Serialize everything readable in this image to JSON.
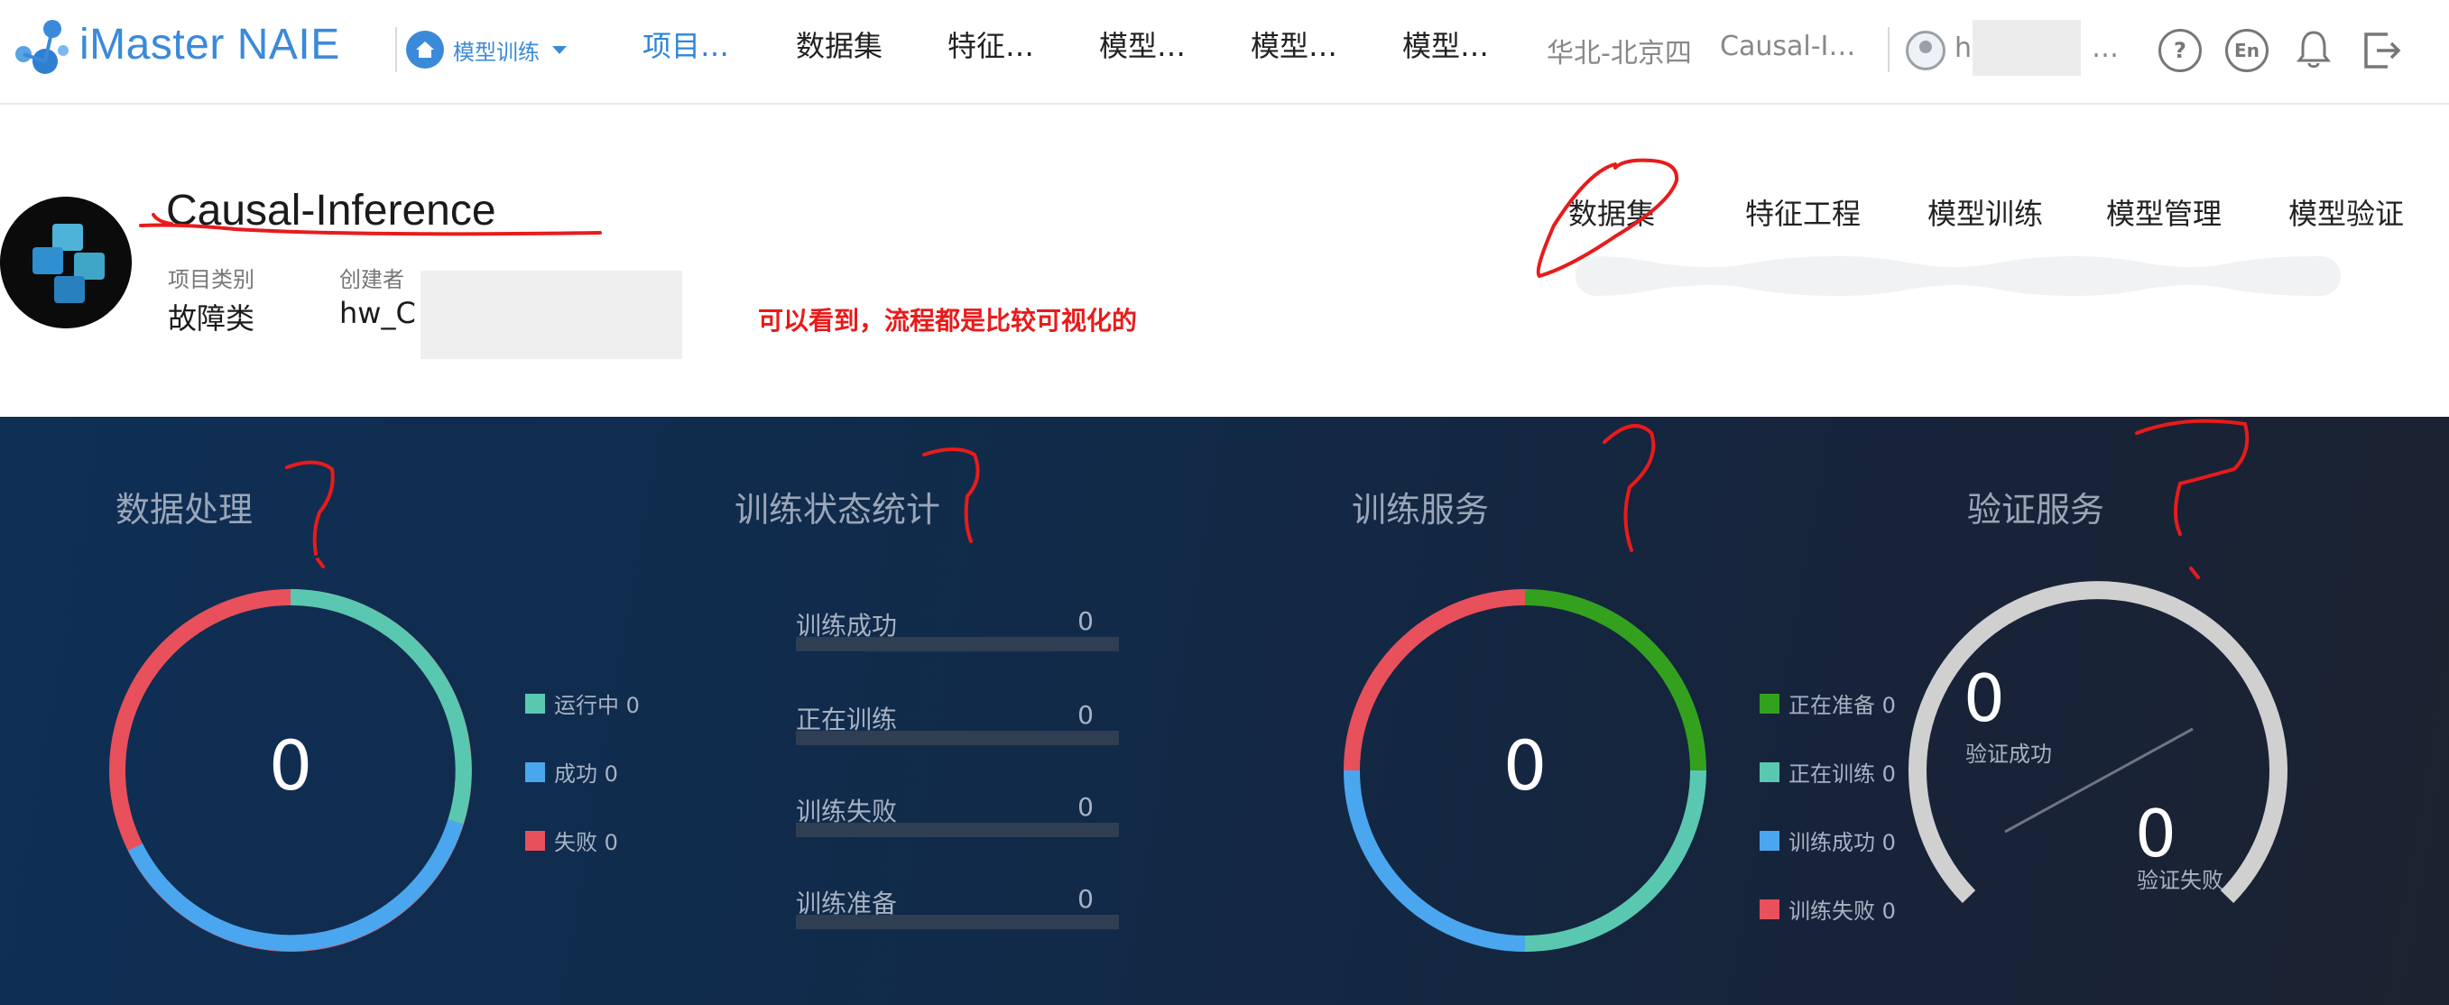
{
  "header": {
    "brand": "iMaster NAIE",
    "module_select": "模型训练",
    "tabs": [
      {
        "label": "项目…",
        "active": true
      },
      {
        "label": "数据集",
        "active": false
      },
      {
        "label": "特征…",
        "active": false
      },
      {
        "label": "模型…",
        "active": false
      },
      {
        "label": "模型…",
        "active": false
      },
      {
        "label": "模型…",
        "active": false
      }
    ],
    "region": "华北-北京四",
    "project_short": "Causal-I…",
    "user_partial": "h",
    "user_ellipsis": "…",
    "lang_label": "En",
    "help_label": "?"
  },
  "project": {
    "name": "Causal-Inference",
    "category_label": "项目类别",
    "category_value": "故障类",
    "creator_label": "创建者",
    "creator_value": "hw_C"
  },
  "annotation": "可以看到，流程都是比较可视化的",
  "flow_tabs": [
    "数据集",
    "特征工程",
    "模型训练",
    "模型管理",
    "模型验证"
  ],
  "dashboard": {
    "data_processing": {
      "title": "数据处理",
      "center": "0",
      "legend": [
        {
          "label": "运行中 0",
          "color": "#5ac8b0"
        },
        {
          "label": "成功 0",
          "color": "#4aa6ee"
        },
        {
          "label": "失败 0",
          "color": "#e8505b"
        }
      ]
    },
    "training_stats": {
      "title": "训练状态统计",
      "rows": [
        {
          "label": "训练成功",
          "value": "0"
        },
        {
          "label": "正在训练",
          "value": "0"
        },
        {
          "label": "训练失败",
          "value": "0"
        },
        {
          "label": "训练准备",
          "value": "0"
        }
      ]
    },
    "training_service": {
      "title": "训练服务",
      "center": "0",
      "legend": [
        {
          "label": "正在准备 0",
          "color": "#33a11e"
        },
        {
          "label": "正在训练 0",
          "color": "#5ac8b0"
        },
        {
          "label": "训练成功 0",
          "color": "#4aa6ee"
        },
        {
          "label": "训练失败 0",
          "color": "#e8505b"
        }
      ]
    },
    "validation_service": {
      "title": "验证服务",
      "success_num": "0",
      "success_label": "验证成功",
      "fail_num": "0",
      "fail_label": "验证失败"
    }
  },
  "icons": {
    "logo": "imaster-logo-icon",
    "home": "home-icon",
    "help": "help-icon",
    "language": "language-icon",
    "bell": "bell-icon",
    "logout": "logout-icon"
  },
  "colors": {
    "brand": "#3b8ad9",
    "annotation_red": "#e81b1b",
    "dash_bg": "#112a48"
  }
}
